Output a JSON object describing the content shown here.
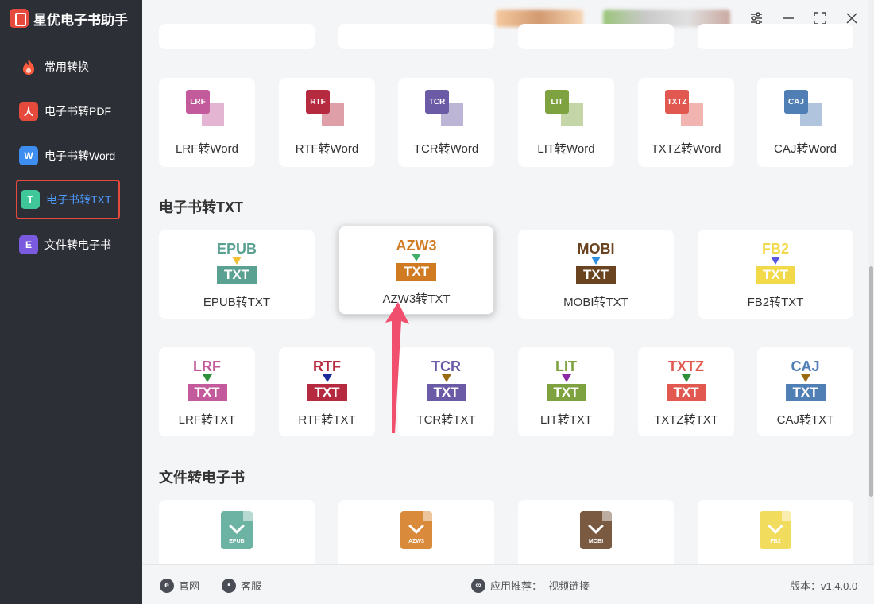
{
  "app": {
    "title": "星优电子书助手"
  },
  "sidebar": {
    "items": [
      {
        "label": "常用转换",
        "icon": "flame-icon"
      },
      {
        "label": "电子书转PDF",
        "icon": "pdf-icon"
      },
      {
        "label": "电子书转Word",
        "icon": "word-icon"
      },
      {
        "label": "电子书转TXT",
        "icon": "txt-icon",
        "active": true
      },
      {
        "label": "文件转电子书",
        "icon": "ebook-icon"
      }
    ]
  },
  "word_row": {
    "cards": [
      {
        "label": "LRF转Word",
        "tag": "LRF",
        "color": "#c35a9b"
      },
      {
        "label": "RTF转Word",
        "tag": "RTF",
        "color": "#b52a3f"
      },
      {
        "label": "TCR转Word",
        "tag": "TCR",
        "color": "#6b5aa5"
      },
      {
        "label": "LIT转Word",
        "tag": "LIT",
        "color": "#7da23f"
      },
      {
        "label": "TXTZ转Word",
        "tag": "TXTZ",
        "color": "#e0584f"
      },
      {
        "label": "CAJ转Word",
        "tag": "CAJ",
        "color": "#4f7fb4"
      }
    ]
  },
  "txt_section": {
    "title": "电子书转TXT",
    "row1": [
      {
        "label": "EPUB转TXT",
        "fmt": "EPUB",
        "color": "#5ba192",
        "arrow": "#f1c232"
      },
      {
        "label": "AZW3转TXT",
        "fmt": "AZW3",
        "color": "#d07a22",
        "arrow": "#3fae6a",
        "hovered": true
      },
      {
        "label": "MOBI转TXT",
        "fmt": "MOBI",
        "color": "#6a4320",
        "arrow": "#2d8fe0"
      },
      {
        "label": "FB2转TXT",
        "fmt": "FB2",
        "color": "#f2d94a",
        "arrow": "#5a57e0"
      }
    ],
    "row2": [
      {
        "label": "LRF转TXT",
        "fmt": "LRF",
        "color": "#c35a9b",
        "arrow": "#2d8f3a"
      },
      {
        "label": "RTF转TXT",
        "fmt": "RTF",
        "color": "#b52a3f",
        "arrow": "#1a2a9a"
      },
      {
        "label": "TCR转TXT",
        "fmt": "TCR",
        "color": "#6b5aa5",
        "arrow": "#9a6a10"
      },
      {
        "label": "LIT转TXT",
        "fmt": "LIT",
        "color": "#7da23f",
        "arrow": "#8a2aa5"
      },
      {
        "label": "TXTZ转TXT",
        "fmt": "TXTZ",
        "color": "#e0584f",
        "arrow": "#2d8f3a"
      },
      {
        "label": "CAJ转TXT",
        "fmt": "CAJ",
        "color": "#4f7fb4",
        "arrow": "#9a6a10"
      }
    ]
  },
  "ebook_section": {
    "title": "文件转电子书",
    "cards": [
      {
        "tag": "EPUB",
        "color": "#6db3a3"
      },
      {
        "tag": "AZW3",
        "color": "#d98a3a"
      },
      {
        "tag": "MOBI",
        "color": "#7a5a40"
      },
      {
        "tag": "FB2",
        "color": "#f2dc5e"
      }
    ]
  },
  "footer": {
    "website": "官网",
    "service": "客服",
    "recommend_label": "应用推荐：",
    "recommend_link": "视频链接",
    "version": "版本：v1.4.0.0"
  },
  "colors": {
    "sidebar_bg": "#2c2f36",
    "accent": "#4e9bff",
    "highlight": "#e64a3c",
    "pointer_arrow": "#f0506e"
  }
}
